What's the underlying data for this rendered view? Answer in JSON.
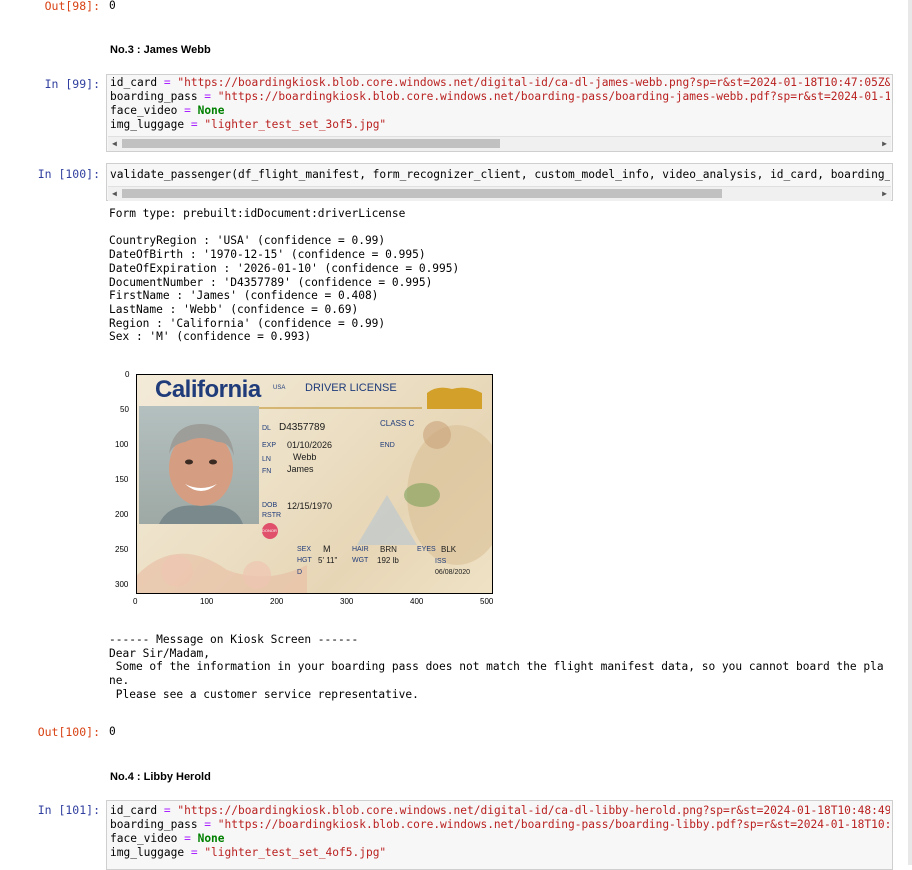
{
  "out98": {
    "prompt": "Out[98]:",
    "value": "0"
  },
  "heading3": "No.3 : James Webb",
  "cell99": {
    "prompt": "In [99]:",
    "l1": {
      "var": "id_card",
      "op": " = ",
      "str": "\"https://boardingkiosk.blob.core.windows.net/digital-id/ca-dl-james-webb.png?sp=r&st=2024-01-18T10:47:05Z&"
    },
    "l2": {
      "var": "boarding_pass",
      "op": " = ",
      "str": "\"https://boardingkiosk.blob.core.windows.net/boarding-pass/boarding-james-webb.pdf?sp=r&st=2024-01-1"
    },
    "l3": {
      "var": "face_video",
      "op": " = ",
      "kw": "None"
    },
    "l4": {
      "var": "img_luggage",
      "op": " = ",
      "str": "\"lighter_test_set_3of5.jpg\""
    }
  },
  "cell100": {
    "prompt": "In [100]:",
    "code": "validate_passenger(df_flight_manifest, form_recognizer_client, custom_model_info, video_analysis, id_card, boarding_",
    "output": "Form type: prebuilt:idDocument:driverLicense\n\nCountryRegion : 'USA' (confidence = 0.99)\nDateOfBirth : '1970-12-15' (confidence = 0.995)\nDateOfExpiration : '2026-01-10' (confidence = 0.995)\nDocumentNumber : 'D4357789' (confidence = 0.995)\nFirstName : 'James' (confidence = 0.408)\nLastName : 'Webb' (confidence = 0.69)\nRegion : 'California' (confidence = 0.99)\nSex : 'M' (confidence = 0.993)",
    "message": "------ Message on Kiosk Screen ------\nDear Sir/Madam,\n Some of the information in your boarding pass does not match the flight manifest data, so you cannot board the pla\nne.\n Please see a customer service representative."
  },
  "plot": {
    "yticks": [
      "0",
      "50",
      "100",
      "150",
      "200",
      "250",
      "300"
    ],
    "xticks": [
      "0",
      "100",
      "200",
      "300",
      "400",
      "500"
    ],
    "license": {
      "state": "California",
      "usa": "USA",
      "type": "DRIVER LICENSE",
      "class_label": "CLASS C",
      "dl_label": "DL",
      "dl": "D4357789",
      "exp_label": "EXP",
      "exp": "01/10/2026",
      "end_label": "END",
      "ln_label": "LN",
      "ln": "Webb",
      "fn_label": "FN",
      "fn": "James",
      "dob_label": "DOB",
      "dob": "12/15/1970",
      "rstr_label": "RSTR",
      "donor": "DONOR",
      "sex_label": "SEX",
      "sex": "M",
      "hair_label": "HAIR",
      "hair": "BRN",
      "eyes_label": "EYES",
      "eyes": "BLK",
      "hgt_label": "HGT",
      "hgt": "5' 11\"",
      "wgt_label": "WGT",
      "wgt": "192 lb",
      "iss_label": "ISS",
      "iss": "06/08/2020",
      "d_label": "D"
    }
  },
  "out100": {
    "prompt": "Out[100]:",
    "value": "0"
  },
  "heading4": "No.4 : Libby Herold",
  "cell101": {
    "prompt": "In [101]:",
    "l1": {
      "var": "id_card",
      "op": " = ",
      "str": "\"https://boardingkiosk.blob.core.windows.net/digital-id/ca-dl-libby-herold.png?sp=r&st=2024-01-18T10:48:49"
    },
    "l2": {
      "var": "boarding_pass",
      "op": " = ",
      "str": "\"https://boardingkiosk.blob.core.windows.net/boarding-pass/boarding-libby.pdf?sp=r&st=2024-01-18T10:"
    },
    "l3": {
      "var": "face_video",
      "op": " = ",
      "kw": "None"
    },
    "l4": {
      "var": "img_luggage",
      "op": " = ",
      "str": "\"lighter_test_set_4of5.jpg\""
    }
  },
  "colors": {
    "in_prompt": "#303f9f",
    "out_prompt": "#d84315",
    "string": "#ba2121",
    "keyword": "#008000"
  }
}
